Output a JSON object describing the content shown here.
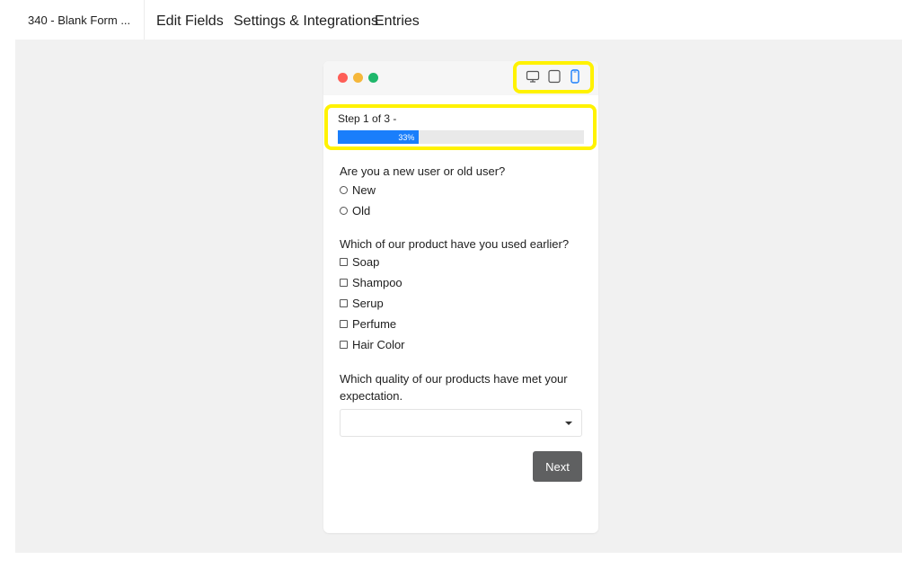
{
  "nav": {
    "form_title": "340 - Blank Form ...",
    "tabs": [
      "Edit Fields",
      "Settings & Integrations",
      "Entries"
    ]
  },
  "preview": {
    "window_dots": [
      "red",
      "yellow",
      "green"
    ],
    "device_icons": [
      "desktop-icon",
      "tablet-icon",
      "mobile-icon"
    ],
    "active_device": "mobile",
    "step_text": "Step 1 of 3 -",
    "progress": {
      "value": 0.33,
      "label": "33%"
    },
    "questions": [
      {
        "label": "Are you a new user or old user?",
        "type": "radio",
        "options": [
          "New",
          "Old"
        ]
      },
      {
        "label": "Which of our product have you used earlier?",
        "type": "checkbox",
        "options": [
          "Soap",
          "Shampoo",
          "Serup",
          "Perfume",
          "Hair Color"
        ]
      },
      {
        "label": "Which quality of our products have met your expectation.",
        "type": "select",
        "selected": ""
      }
    ],
    "next_label": "Next"
  },
  "colors": {
    "highlight": "#fff200",
    "progress_fill": "#1a7efb",
    "next_button": "#5f6061",
    "canvas_bg": "#f1f1f1"
  }
}
